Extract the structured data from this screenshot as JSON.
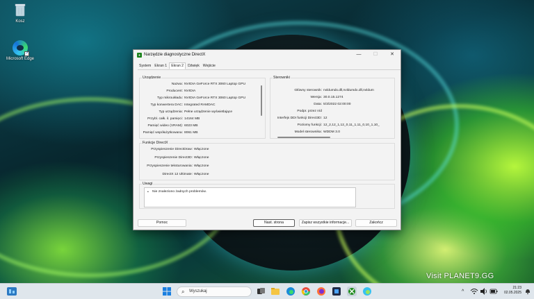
{
  "desktop": {
    "icons": [
      {
        "label": "Kosz",
        "icon": "recycle-bin-icon"
      },
      {
        "label": "Microsoft Edge",
        "icon": "edge-browser-icon"
      }
    ],
    "watermark": "Visit PLANET9.GG"
  },
  "window": {
    "title": "Narzędzie diagnostyczne DirectX",
    "controls": {
      "minimize": "—",
      "maximize": "☐",
      "close": "✕"
    },
    "tabs": [
      "System",
      "Ekran 1",
      "Ekran 2",
      "Dźwięk",
      "Wejście"
    ],
    "active_tab": "Ekran 2",
    "device": {
      "title": "Urządzenie",
      "rows": [
        {
          "k": "Nazwa:",
          "v": "NVIDIA GeForce RTX 3060 Laptop GPU"
        },
        {
          "k": "Producent:",
          "v": "NVIDIA"
        },
        {
          "k": "Typ mikroukładu:",
          "v": "NVIDIA GeForce RTX 3060 Laptop GPU"
        },
        {
          "k": "Typ konwertera DAC:",
          "v": "Integrated RAMDAC"
        },
        {
          "k": "Typ urządzenia:",
          "v": "Pełne urządzenie wyświetlające"
        },
        {
          "k": "Przybl. całk. il. pamięci:",
          "v": "14164 MB"
        },
        {
          "k": "Pamięć wideo (VRAM):",
          "v": "6023 MB"
        },
        {
          "k": "Pamięć współużytkowana:",
          "v": "8061 MB"
        }
      ]
    },
    "drivers": {
      "title": "Sterowniki",
      "rows": [
        {
          "k": "Główny sterownik:",
          "v": "nvldumdx.dll,nvldumdx.dll,nvldum"
        },
        {
          "k": "Wersja:",
          "v": "30.0.15.1274"
        },
        {
          "k": "Data:",
          "v": "5/3/2022 02:00:00"
        },
        {
          "k": "Podpr. przez n/d",
          "v": ""
        },
        {
          "k": "Interfejs DDI funkcji Direct3D:",
          "v": "12"
        },
        {
          "k": "Poziomy funkcji:",
          "v": "12_2,12_1,12_0,11_1,11_0,10_1,10_"
        },
        {
          "k": "Model sterownika:",
          "v": "WDDM 3.0"
        }
      ]
    },
    "directx_features": {
      "title": "Funkcje DirectX",
      "rows": [
        {
          "k": "Przyspieszenie DirectDraw:",
          "v": "Włączone"
        },
        {
          "k": "Przyspieszenie Direct3D:",
          "v": "Włączone"
        },
        {
          "k": "Przyspieszenie teksturowania:",
          "v": "Włączone"
        },
        {
          "k": "DirectX 12 Ultimate:",
          "v": "Włączone"
        }
      ]
    },
    "notes": {
      "title": "Uwagi",
      "bullet": "•",
      "text": "Nie znaleziono żadnych problemów."
    },
    "buttons": {
      "help": "Pomoc",
      "next_page": "Nast. strona",
      "save_all": "Zapisz wszystkie informacje...",
      "exit": "Zakończ"
    }
  },
  "taskbar": {
    "search_placeholder": "Wyszukaj",
    "time": "21:23",
    "date": "02.05.2025",
    "pinned": [
      "windows-start-icon",
      "task-view-icon",
      "file-explorer-icon",
      "edge-icon",
      "chrome-icon",
      "firefox-icon",
      "store-icon",
      "dxdiag-icon",
      "edge-beta-icon"
    ]
  }
}
